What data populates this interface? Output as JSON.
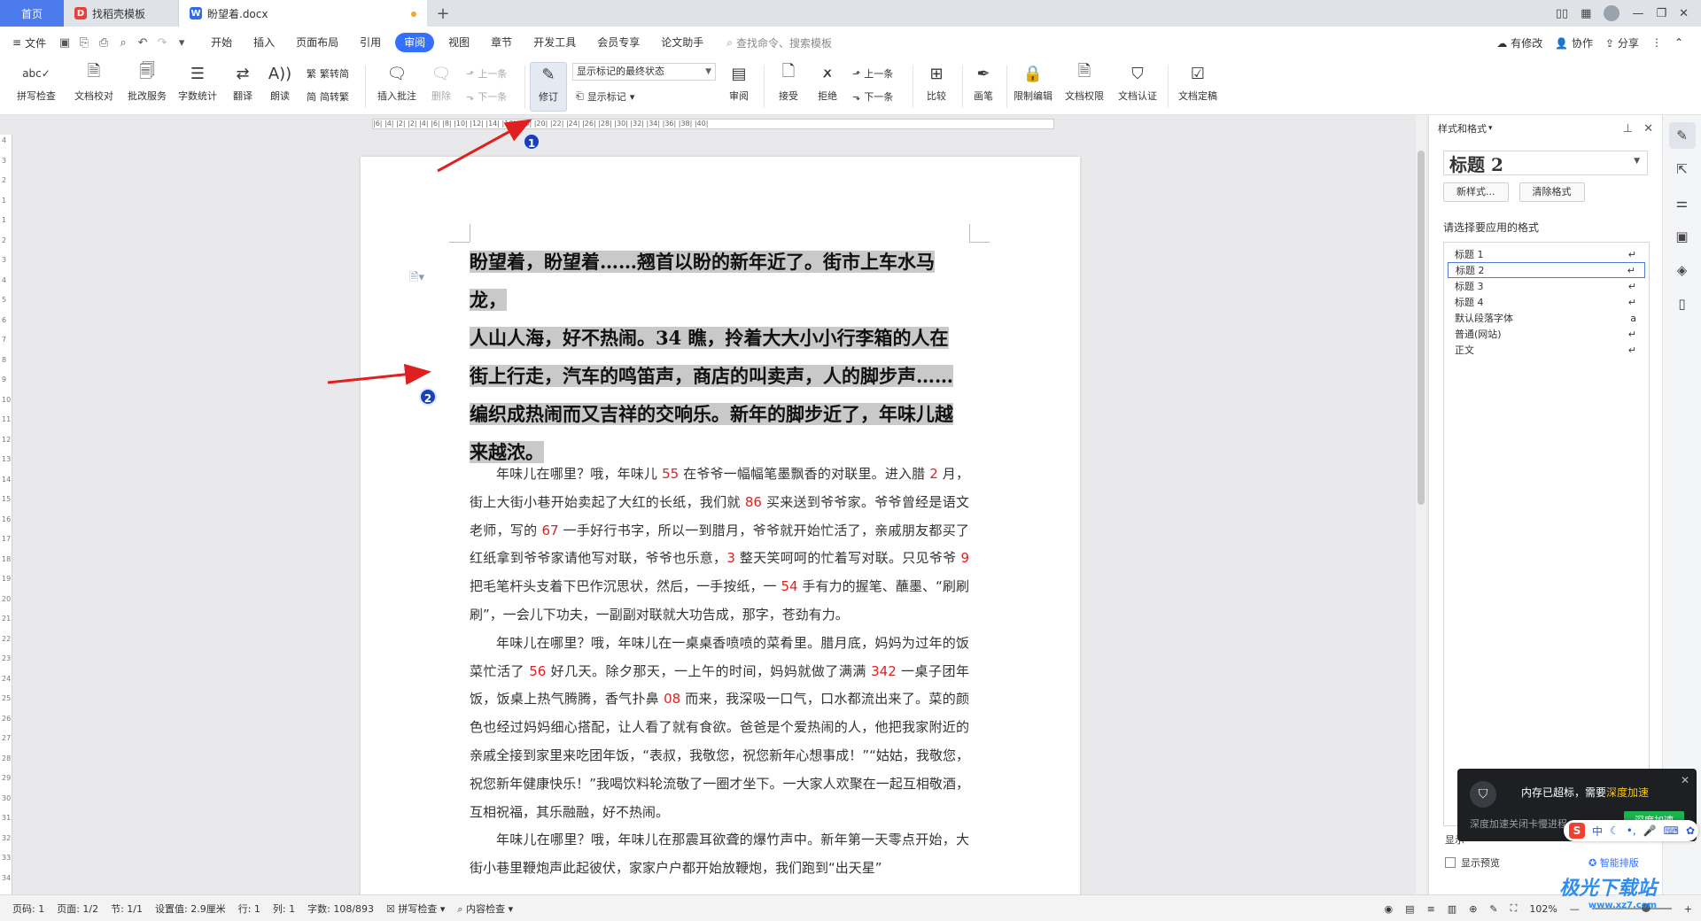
{
  "tabs": {
    "home": "首页",
    "template": "找稻壳模板",
    "document": "盼望着.docx"
  },
  "menu": {
    "file": "文件",
    "tabs": [
      "开始",
      "插入",
      "页面布局",
      "引用",
      "审阅",
      "视图",
      "章节",
      "开发工具",
      "会员专享",
      "论文助手"
    ],
    "active_tab": "审阅",
    "search": "查找命令、搜索模板",
    "right": {
      "changes": "有修改",
      "collab": "协作",
      "share": "分享"
    }
  },
  "ribbon": {
    "spellcheck": "拼写检查",
    "proofread": "文档校对",
    "batch": "批改服务",
    "wordcount": "字数统计",
    "translate": "翻译",
    "read": "朗读",
    "to_trad": "繁转简",
    "to_simp": "简转繁",
    "insert_comment": "插入批注",
    "delete": "删除",
    "prev": "上一条",
    "next": "下一条",
    "track": "修订",
    "display_state": "显示标记的最终状态",
    "show_markup": "显示标记",
    "review": "审阅",
    "accept": "接受",
    "reject": "拒绝",
    "prev2": "上一条",
    "next2": "下一条",
    "compare": "比较",
    "pen": "画笔",
    "restrict": "限制编辑",
    "permission": "文档权限",
    "certify": "文档认证",
    "finalize": "文档定稿"
  },
  "ruler_text": "|6| |4| |2| |2| |4| |6| |8| |10| |12| |14| |16| |18| |20| |22| |24| |26| |28| |30| |32| |34| |36| |38| |40|",
  "vruler": [
    "4",
    "3",
    "2",
    "1",
    "1",
    "2",
    "3",
    "4",
    "5",
    "6",
    "7",
    "8",
    "9",
    "10",
    "11",
    "12",
    "13",
    "14",
    "15",
    "16",
    "17",
    "18",
    "19",
    "20",
    "21",
    "22",
    "23",
    "24",
    "25",
    "26",
    "27",
    "28",
    "29",
    "30",
    "31",
    "32",
    "33",
    "34"
  ],
  "annotations": {
    "badge1": "1",
    "badge2": "2"
  },
  "document": {
    "heading_lines": [
      "盼望着，盼望着……翘首以盼的新年近了。街市上车水马龙，",
      "人山人海，好不热闹。34 瞧，拎着大大小小行李箱的人在",
      "街上行走，汽车的鸣笛声，商店的叫卖声，人的脚步声……",
      "编织成热闹而又吉祥的交响乐。新年的脚步近了，年味儿越",
      "来越浓。"
    ],
    "paragraphs": [
      [
        {
          "t": "年味儿在哪里？哦，年味儿 "
        },
        {
          "t": "55",
          "n": true
        },
        {
          "t": " 在爷爷一幅幅笔墨飘香的对联里。进入腊 "
        },
        {
          "t": "2",
          "n": true
        },
        {
          "t": " 月，街上大街小巷开始卖起了大红的长纸，我们就 "
        },
        {
          "t": "86",
          "n": true
        },
        {
          "t": " 买来送到爷爷家。爷爷曾经是语文老师，写的 "
        },
        {
          "t": "67",
          "n": true
        },
        {
          "t": " 一手好行书字，所以一到腊月，爷爷就开始忙活了，亲戚朋友都买了红纸拿到爷爷家请他写对联，爷爷也乐意，"
        },
        {
          "t": "3",
          "n": true
        },
        {
          "t": " 整天笑呵呵的忙着写对联。只见爷爷 "
        },
        {
          "t": "9",
          "n": true
        },
        {
          "t": " 把毛笔杆头支着下巴作沉思状，然后，一手按纸，一 "
        },
        {
          "t": "54",
          "n": true
        },
        {
          "t": " 手有力的握笔、蘸墨、“刷刷刷”，一会儿下功夫，一副副对联就大功告成，那字，苍劲有力。"
        }
      ],
      [
        {
          "t": "年味儿在哪里？哦，年味儿在一桌桌香喷喷的菜肴里。腊月底，妈妈为过年的饭菜忙活了 "
        },
        {
          "t": "56",
          "n": true
        },
        {
          "t": " 好几天。除夕那天，一上午的时间，妈妈就做了满满 "
        },
        {
          "t": "342",
          "n": true
        },
        {
          "t": " 一桌子团年饭，饭桌上热气腾腾，香气扑鼻 "
        },
        {
          "t": "08",
          "n": true
        },
        {
          "t": " 而来，我深吸一口气，口水都流出来了。菜的颜色也经过妈妈细心搭配，让人看了就有食欲。爸爸是个爱热闹的人，他把我家附近的亲戚全接到家里来吃团年饭，“表叔，我敬您，祝您新年心想事成！”“姑姑，我敬您，祝您新年健康快乐！”我喝饮料轮流敬了一圈才坐下。一大家人欢聚在一起互相敬酒，互相祝福，其乐融融，好不热闹。"
        }
      ],
      [
        {
          "t": "年味儿在哪里？哦，年味儿在那震耳欲聋的爆竹声中。新年第一天零点开始，大街小巷里鞭炮声此起彼伏，家家户户都开始放鞭炮，我们跑到“出天星”"
        }
      ]
    ]
  },
  "panel": {
    "title": "样式和格式",
    "current_style": "标题  2",
    "new_style": "新样式...",
    "clear_format": "清除格式",
    "prompt": "请选择要应用的格式",
    "styles": [
      "标题 1",
      "标题 2",
      "标题 3",
      "标题 4",
      "默认段落字体",
      "普通(网站)",
      "正文"
    ],
    "selected_style": "标题 2",
    "show_label": "显示",
    "preview": "显示预览",
    "smart_layout": "智能排版"
  },
  "popup": {
    "message": "内存已超标，需要",
    "accent": "深度加速",
    "sub": "深度加速关闭卡慢进程",
    "button": "深度加速"
  },
  "ime": {
    "mode": "中"
  },
  "statusbar": {
    "page": "页码: 1",
    "pages": "页面: 1/2",
    "section": "节: 1/1",
    "setting": "设置值: 2.9厘米",
    "row": "行: 1",
    "col": "列: 1",
    "wordcount": "字数: 108/893",
    "spellcheck": "拼写检查",
    "content_check": "内容检查",
    "zoom": "102%"
  },
  "watermark": {
    "brand": "极光下载站",
    "url": "www.xz7.com"
  },
  "colors": {
    "accent": "#3370ff",
    "highlight": "#c9c9c9",
    "number_red": "#e02020",
    "arrow": "#e02020",
    "badge": "#1b3fb8"
  }
}
